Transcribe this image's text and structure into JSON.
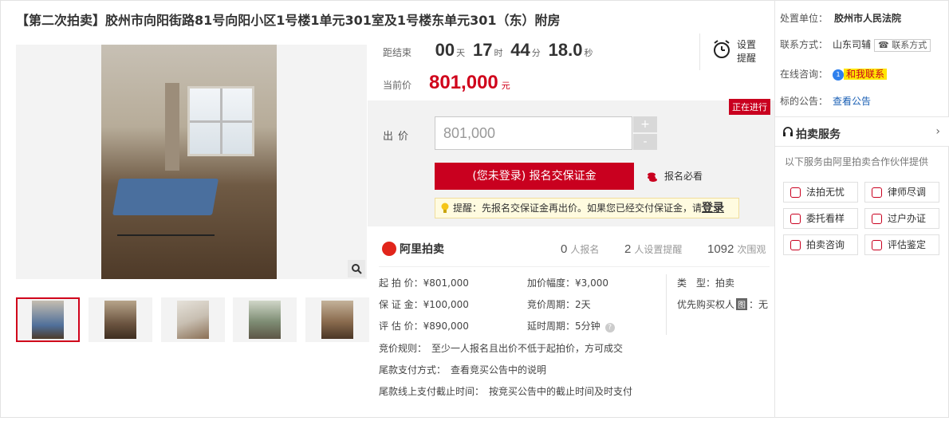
{
  "title": "【第二次拍卖】胶州市向阳街路81号向阳小区1号楼1单元301室及1号楼东单元301（东）附房",
  "countdown": {
    "label": "距结束",
    "days": "00",
    "days_unit": "天",
    "hours": "17",
    "hours_unit": "时",
    "minutes": "44",
    "minutes_unit": "分",
    "seconds": "18.0",
    "seconds_unit": "秒"
  },
  "current_price": {
    "label": "当前价",
    "value": "801,000",
    "unit": "元"
  },
  "remind": {
    "label": "设置提醒",
    "icon": "alarm-clock-icon"
  },
  "status_tag": "正在进行",
  "bid": {
    "label": "出价",
    "input_value": "801,000",
    "plus": "+",
    "minus": "-",
    "signup_button": "(您未登录) 报名交保证金",
    "must_read": "报名必看",
    "tip": "提醒：先报名交保证金再出价。如果您已经交付保证金，请",
    "tip_login": "登录"
  },
  "stats": {
    "brand": "阿里拍卖",
    "signups_num": "0",
    "signups_label": "人报名",
    "reminders_num": "2",
    "reminders_label": "人设置提醒",
    "views_num": "1092",
    "views_label": "次围观"
  },
  "details": {
    "start_price": "起 拍 价：¥801,000",
    "deposit": "保 证 金：¥100,000",
    "appraisal": "评 估 价：¥890,000",
    "increment": "加价幅度：¥3,000",
    "cycle": "竞价周期：2天",
    "delay": "延时周期：5分钟",
    "type_label": "类　型：",
    "type_value": "拍卖",
    "priority": "优先购买权人",
    "priority_mark": "图",
    "priority_value": "：无",
    "rule": "竞价规则：　至少一人报名且出价不低于起拍价，方可成交",
    "payment": "尾款支付方式：　查看竞买公告中的说明",
    "deadline": "尾款线上支付截止时间：　按竞买公告中的截止时间及时支付"
  },
  "side": {
    "court_label": "处置单位：",
    "court_value": "胶州市人民法院",
    "contact_label": "联系方式：",
    "contact_value": "山东司辅",
    "contact_tag": "联系方式",
    "consult_label": "在线咨询：",
    "consult_badge": "1",
    "consult_value": "和我联系",
    "notice_label": "标的公告：",
    "notice_value": "查看公告"
  },
  "service": {
    "title": "拍卖服务",
    "subtitle": "以下服务由阿里拍卖合作伙伴提供",
    "items": [
      "法拍无忧",
      "律师尽调",
      "委托看样",
      "过户办证",
      "拍卖咨询",
      "评估鉴定"
    ]
  },
  "colors": {
    "accent": "#c9001f",
    "link": "#1a5fb4",
    "tip_bg": "#fffbe0"
  }
}
